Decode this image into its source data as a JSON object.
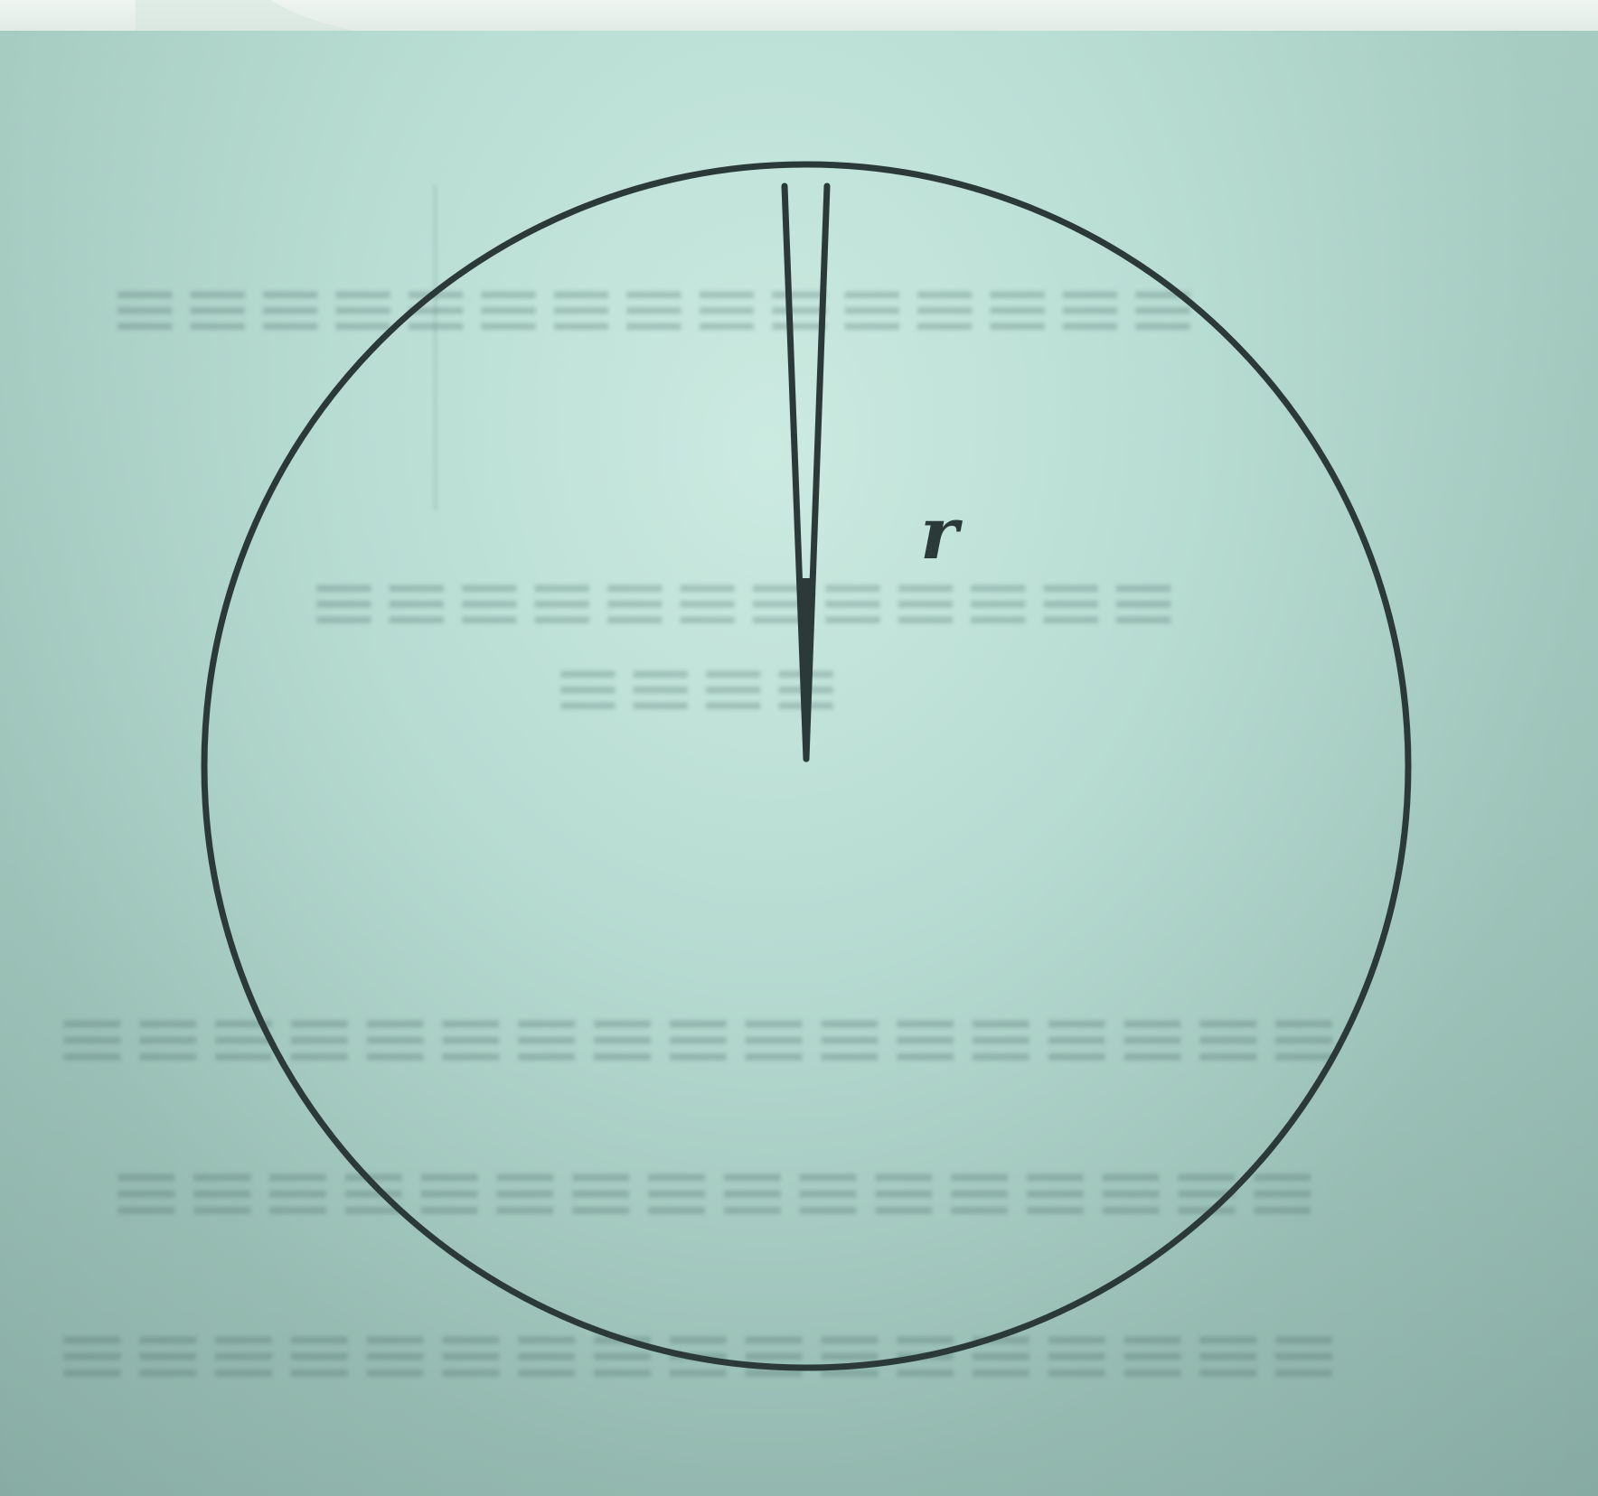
{
  "diagram": {
    "radius_label": "r",
    "colors": {
      "line": "#2b3a38",
      "paper_light": "#c4e4da",
      "paper_dark": "#8fb0a8",
      "top_strip": "#e8f1ec"
    }
  }
}
